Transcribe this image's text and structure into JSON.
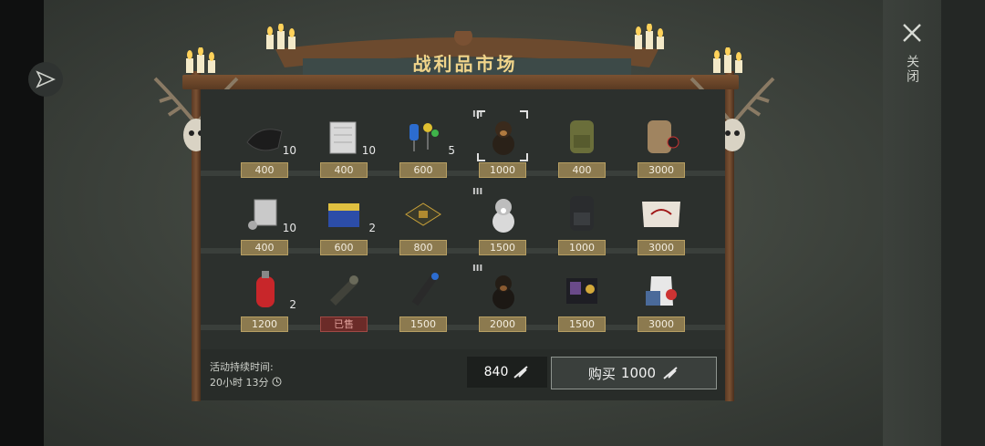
{
  "title": "战利品市场",
  "close_label": "关闭",
  "rows": [
    [
      {
        "icon": "leather-icon",
        "qty": "10",
        "price": "400",
        "tier": ""
      },
      {
        "icon": "cloth-icon",
        "qty": "10",
        "price": "400",
        "tier": ""
      },
      {
        "icon": "electronic-parts-icon",
        "qty": "5",
        "price": "600",
        "tier": ""
      },
      {
        "icon": "dog-puppy-icon",
        "qty": "",
        "price": "1000",
        "tier": "III"
      },
      {
        "icon": "green-backpack-icon",
        "qty": "",
        "price": "400",
        "tier": ""
      },
      {
        "icon": "tan-backpack-icon",
        "qty": "",
        "price": "3000",
        "tier": ""
      }
    ],
    [
      {
        "icon": "engine-cylinder-icon",
        "qty": "10",
        "price": "400",
        "tier": ""
      },
      {
        "icon": "car-battery-icon",
        "qty": "2",
        "price": "600",
        "tier": ""
      },
      {
        "icon": "circuit-board-icon",
        "qty": "",
        "price": "800",
        "tier": ""
      },
      {
        "icon": "husky-puppy-icon",
        "qty": "",
        "price": "1500",
        "tier": "III"
      },
      {
        "icon": "black-backpack-icon",
        "qty": "",
        "price": "1000",
        "tier": ""
      },
      {
        "icon": "flag-icon",
        "qty": "",
        "price": "3000",
        "tier": ""
      }
    ],
    [
      {
        "icon": "gas-cylinder-icon",
        "qty": "2",
        "price": "1200",
        "tier": ""
      },
      {
        "icon": "gearbox-icon",
        "qty": "",
        "price": "已售",
        "tier": "",
        "sold": true
      },
      {
        "icon": "silencer-icon",
        "qty": "",
        "price": "1500",
        "tier": ""
      },
      {
        "icon": "rottweiler-puppy-icon",
        "qty": "",
        "price": "2000",
        "tier": "III"
      },
      {
        "icon": "police-badge-icon",
        "qty": "",
        "price": "1500",
        "tier": ""
      },
      {
        "icon": "outfit-icon",
        "qty": "",
        "price": "3000",
        "tier": ""
      }
    ]
  ],
  "duration_label": "活动持续时间:",
  "duration_value": "20小时 13分",
  "balance": "840",
  "buy_label": "购买",
  "buy_price": "1000",
  "colors": {
    "price_bg": "#8c7a4f",
    "sold_bg": "#6b2b28",
    "title": "#f0d48a"
  }
}
